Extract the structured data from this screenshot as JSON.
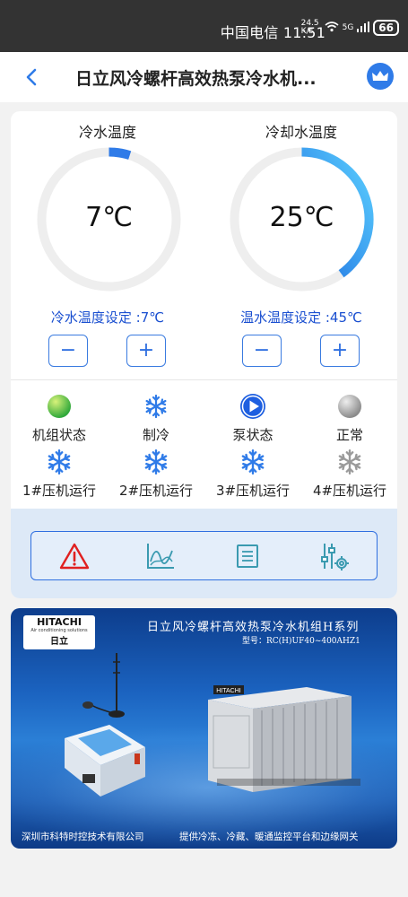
{
  "status_bar": {
    "carrier": "中国电信",
    "time": "11:51",
    "speed": "24.5 K/s",
    "network": "5G",
    "battery": "66"
  },
  "header": {
    "title": "日立风冷螺杆高效热泵冷水机..."
  },
  "gauges": [
    {
      "label": "冷水温度",
      "value": "7℃",
      "fill_fraction": 0.05,
      "setpoint": "冷水温度设定 :7℃"
    },
    {
      "label": "冷却水温度",
      "value": "25℃",
      "fill_fraction": 0.4,
      "setpoint": "温水温度设定 :45℃"
    }
  ],
  "controls": {
    "minus": "−",
    "plus": "+"
  },
  "status": {
    "row1": [
      {
        "label": "机组状态",
        "icon": "green-dot-icon"
      },
      {
        "label": "制冷",
        "icon": "snowflake-icon"
      },
      {
        "label": "泵状态",
        "icon": "play-icon"
      },
      {
        "label": "正常",
        "icon": "gray-dot-icon"
      }
    ],
    "row2": [
      {
        "label": "1#压机运行",
        "icon": "snowflake-icon"
      },
      {
        "label": "2#压机运行",
        "icon": "snowflake-icon"
      },
      {
        "label": "3#压机运行",
        "icon": "snowflake-icon"
      },
      {
        "label": "4#压机运行",
        "icon": "snowflake-gray-icon"
      }
    ]
  },
  "toolbar": [
    "alarm-icon",
    "chart-icon",
    "list-icon",
    "settings-sliders-icon"
  ],
  "banner": {
    "brand": "HITACHI",
    "brand_sub": "Air conditioning solutions",
    "brand_cn": "日立",
    "title": "日立风冷螺杆高效热泵冷水机组H系列",
    "model": "型号：RC(H)UF40~400AHZ1",
    "footer_left": "深圳市科特时控技术有限公司",
    "footer_right": "提供冷冻、冷藏、暖通监控平台和边缘网关"
  },
  "colors": {
    "accent": "#2f7be8",
    "gauge_track": "#eeeeee",
    "gauge_fill_start": "#1e6fe0",
    "gauge_fill_end": "#5cd0ff",
    "setpoint_text": "#1a4fd0",
    "alarm": "#e02020",
    "tool_icon": "#3a9ab0"
  }
}
